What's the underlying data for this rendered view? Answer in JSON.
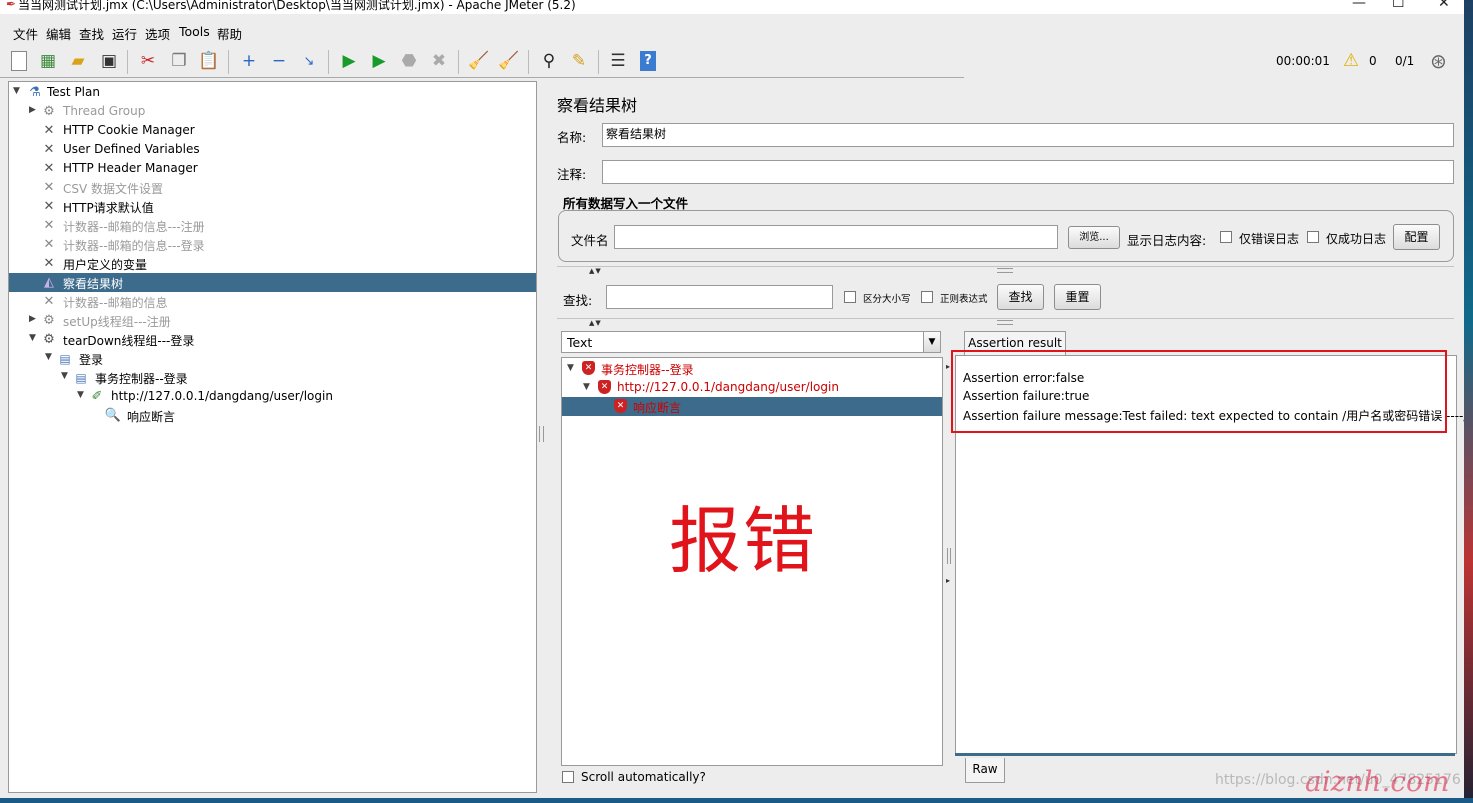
{
  "window": {
    "title": "当当网测试计划.jmx (C:\\Users\\Administrator\\Desktop\\当当网测试计划.jmx) - Apache JMeter (5.2)"
  },
  "menu": [
    "文件",
    "编辑",
    "查找",
    "运行",
    "选项",
    "Tools",
    "帮助"
  ],
  "toolbar": {
    "timer": "00:00:01",
    "warnings": "0",
    "threads": "0/1"
  },
  "tree": {
    "items": [
      {
        "label": "Test Plan"
      },
      {
        "label": "Thread Group"
      },
      {
        "label": "HTTP Cookie Manager"
      },
      {
        "label": "User Defined Variables"
      },
      {
        "label": "HTTP Header Manager"
      },
      {
        "label": "CSV 数据文件设置"
      },
      {
        "label": "HTTP请求默认值"
      },
      {
        "label": "计数器--邮箱的信息---注册"
      },
      {
        "label": "计数器--邮箱的信息---登录"
      },
      {
        "label": "用户定义的变量"
      },
      {
        "label": "察看结果树"
      },
      {
        "label": "计数器--邮箱的信息"
      },
      {
        "label": "setUp线程组---注册"
      },
      {
        "label": "tearDown线程组---登录"
      },
      {
        "label": "登录"
      },
      {
        "label": "事务控制器--登录"
      },
      {
        "label": "http://127.0.0.1/dangdang/user/login"
      },
      {
        "label": "响应断言"
      }
    ]
  },
  "panel": {
    "title": "察看结果树",
    "name_label": "名称:",
    "name_value": "察看结果树",
    "comment_label": "注释:",
    "comment_value": "",
    "file_group_title": "所有数据写入一个文件",
    "filename_label": "文件名",
    "filename_value": "",
    "browse_button": "浏览...",
    "log_content_label": "显示日志内容:",
    "errors_only_label": "仅错误日志",
    "success_only_label": "仅成功日志",
    "configure_button": "配置",
    "search_label": "查找:",
    "search_value": "",
    "case_sensitive_label": "区分大小写",
    "regex_label": "正则表达式",
    "find_button": "查找",
    "reset_button": "重置",
    "renderer": "Text",
    "scroll_auto_label": "Scroll automatically?"
  },
  "results": {
    "items": [
      {
        "label": "事务控制器--登录"
      },
      {
        "label": "http://127.0.0.1/dangdang/user/login"
      },
      {
        "label": "响应断言"
      }
    ],
    "tab_label": "Assertion result",
    "raw_tab_label": "Raw",
    "lines": [
      "Assertion error:false",
      "Assertion failure:true",
      "Assertion failure message:Test failed: text expected to contain /用户名或密码错误 ----/"
    ]
  },
  "annotation": {
    "text": "报错",
    "color": "#e0141a"
  },
  "watermark": {
    "text": "https://blog.csdn.net/u0_47825176",
    "site": "aiznh.com"
  }
}
